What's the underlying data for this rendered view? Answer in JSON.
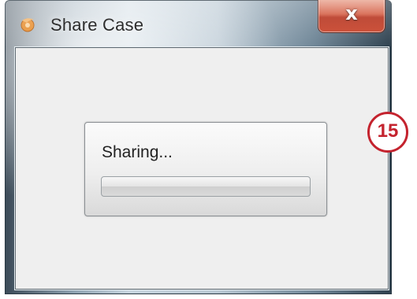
{
  "window": {
    "title": "Share Case",
    "app_icon": "orange-swirl-icon",
    "close_label": "x"
  },
  "progress": {
    "label": "Sharing...",
    "fraction": 0.0
  },
  "annotation": {
    "step_number": "15"
  },
  "colors": {
    "close_button": "#c8432a",
    "callout": "#c4232e",
    "client_background": "#efefef"
  }
}
